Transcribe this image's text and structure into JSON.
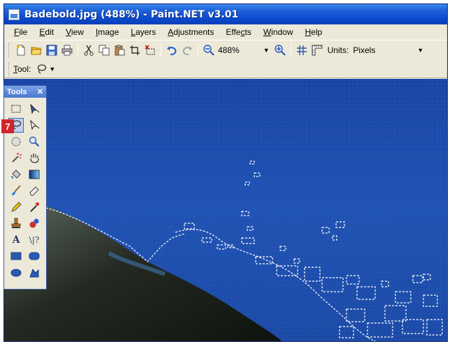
{
  "window": {
    "title": "Badebold.jpg (488%) - Paint.NET v3.01"
  },
  "menu": [
    {
      "label": "File",
      "key": "F",
      "rest": "ile"
    },
    {
      "label": "Edit",
      "key": "E",
      "rest": "dit"
    },
    {
      "label": "View",
      "key": "V",
      "rest": "iew"
    },
    {
      "label": "Image",
      "key": "I",
      "rest": "mage"
    },
    {
      "label": "Layers",
      "key": "L",
      "rest": "ayers"
    },
    {
      "label": "Adjustments",
      "key": "A",
      "rest": "djustments"
    },
    {
      "label": "Effects",
      "pre": "Effe",
      "key": "c",
      "rest": "ts"
    },
    {
      "label": "Window",
      "key": "W",
      "rest": "indow"
    },
    {
      "label": "Help",
      "key": "H",
      "rest": "elp"
    }
  ],
  "toolbar": {
    "zoom_value": "488%",
    "units_label": "Units:",
    "units_value": "Pixels"
  },
  "tool_options": {
    "tool_key": "T",
    "tool_rest": "ool:"
  },
  "tools_panel": {
    "title": "Tools",
    "close_glyph": "✕",
    "text_tool": "A",
    "line_tool": "\\|?",
    "step_badge": "7"
  },
  "colors": {
    "title_bar": "#0b4ad0",
    "canvas_water": "#1e4aa8",
    "window_chrome": "#ece9d8",
    "selection_outline": "#ffffff",
    "step_badge": "#d4242a"
  }
}
